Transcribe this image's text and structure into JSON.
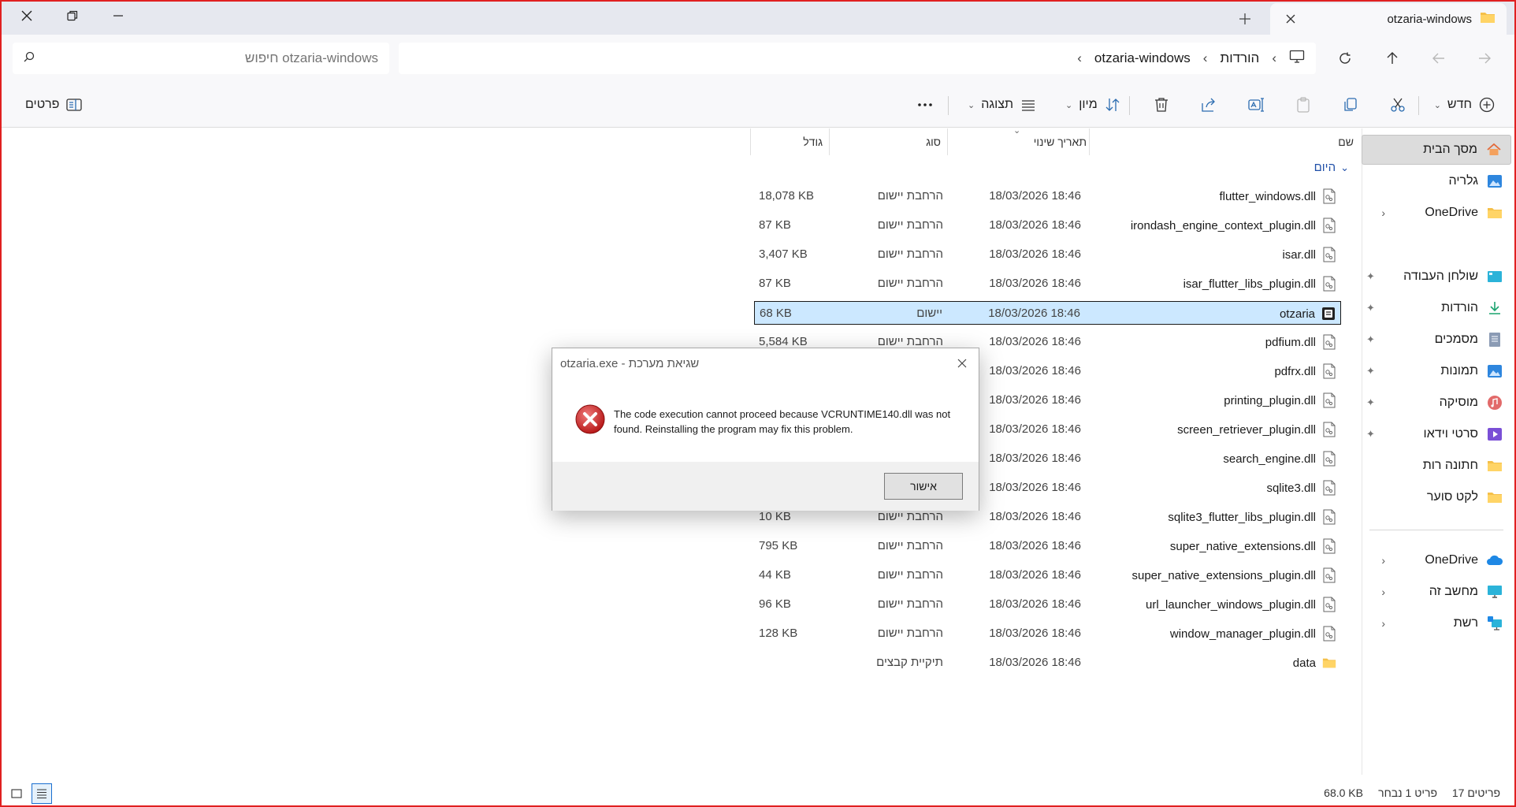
{
  "window": {
    "tab_title": "otzaria-windows"
  },
  "address": {
    "crumbs": [
      "הורדות",
      "otzaria-windows"
    ],
    "search_placeholder": "חיפוש otzaria-windows"
  },
  "commandbar": {
    "new_label": "חדש",
    "sort_label": "מיון",
    "view_label": "תצוגה",
    "details_label": "פרטים"
  },
  "columns": {
    "name": "שם",
    "date": "תאריך שינוי",
    "type": "סוג",
    "size": "גודל"
  },
  "group_label": "היום",
  "sidebar": {
    "home": "מסך הבית",
    "gallery": "גלריה",
    "onedrive_personal": "OneDrive",
    "desktop": "שולחן העבודה",
    "downloads": "הורדות",
    "documents": "מסמכים",
    "pictures": "תמונות",
    "music": "מוסיקה",
    "videos": "סרטי וידאו",
    "folder1": "חתונה רות",
    "folder2": "לקט סוער",
    "onedrive": "OneDrive",
    "this_pc": "מחשב זה",
    "network": "רשת"
  },
  "files": [
    {
      "name": "flutter_windows.dll",
      "date": "18/03/2026 18:46",
      "type": "הרחבת יישום",
      "size": "18,078 KB"
    },
    {
      "name": "irondash_engine_context_plugin.dll",
      "date": "18/03/2026 18:46",
      "type": "הרחבת יישום",
      "size": "87 KB"
    },
    {
      "name": "isar.dll",
      "date": "18/03/2026 18:46",
      "type": "הרחבת יישום",
      "size": "3,407 KB"
    },
    {
      "name": "isar_flutter_libs_plugin.dll",
      "date": "18/03/2026 18:46",
      "type": "הרחבת יישום",
      "size": "87 KB"
    },
    {
      "name": "otzaria",
      "date": "18/03/2026 18:46",
      "type": "יישום",
      "size": "68 KB"
    },
    {
      "name": "pdfium.dll",
      "date": "18/03/2026 18:46",
      "type": "הרחבת יישום",
      "size": "5,584 KB"
    },
    {
      "name": "pdfrx.dll",
      "date": "18/03/2026 18:46",
      "type": "",
      "size": ""
    },
    {
      "name": "printing_plugin.dll",
      "date": "18/03/2026 18:46",
      "type": "",
      "size": ""
    },
    {
      "name": "screen_retriever_plugin.dll",
      "date": "18/03/2026 18:46",
      "type": "",
      "size": ""
    },
    {
      "name": "search_engine.dll",
      "date": "18/03/2026 18:46",
      "type": "",
      "size": ""
    },
    {
      "name": "sqlite3.dll",
      "date": "18/03/2026 18:46",
      "type": "",
      "size": ""
    },
    {
      "name": "sqlite3_flutter_libs_plugin.dll",
      "date": "18/03/2026 18:46",
      "type": "הרחבת יישום",
      "size": "10 KB"
    },
    {
      "name": "super_native_extensions.dll",
      "date": "18/03/2026 18:46",
      "type": "הרחבת יישום",
      "size": "795 KB"
    },
    {
      "name": "super_native_extensions_plugin.dll",
      "date": "18/03/2026 18:46",
      "type": "הרחבת יישום",
      "size": "44 KB"
    },
    {
      "name": "url_launcher_windows_plugin.dll",
      "date": "18/03/2026 18:46",
      "type": "הרחבת יישום",
      "size": "96 KB"
    },
    {
      "name": "window_manager_plugin.dll",
      "date": "18/03/2026 18:46",
      "type": "הרחבת יישום",
      "size": "128 KB"
    },
    {
      "name": "data",
      "date": "18/03/2026 18:46",
      "type": "תיקיית קבצים",
      "size": ""
    }
  ],
  "status": {
    "count": "17 פריטים",
    "selected": "פריט 1 נבחר",
    "selected_size": "68.0 KB"
  },
  "dialog": {
    "title": "otzaria.exe - שגיאת מערכת",
    "message": "The code execution cannot proceed because VCRUNTIME140.dll was not found. Reinstalling the program may fix this problem.",
    "ok": "אישור"
  }
}
